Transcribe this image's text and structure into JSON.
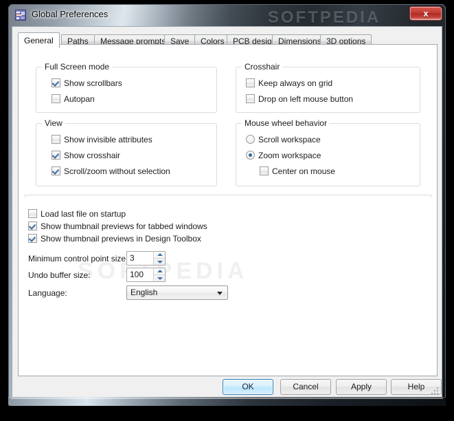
{
  "window": {
    "title": "Global Preferences",
    "icon": "app-icon",
    "close_label": "x",
    "watermark": "SOFTPEDIA"
  },
  "tabs": [
    {
      "label": "General",
      "active": true
    },
    {
      "label": "Paths",
      "active": false
    },
    {
      "label": "Message prompts",
      "active": false
    },
    {
      "label": "Save",
      "active": false
    },
    {
      "label": "Colors",
      "active": false
    },
    {
      "label": "PCB design",
      "active": false
    },
    {
      "label": "Dimensions",
      "active": false
    },
    {
      "label": "3D options",
      "active": false
    }
  ],
  "groups": {
    "fullscreen": {
      "title": "Full Screen mode",
      "options": [
        {
          "label": "Show scrollbars",
          "checked": true
        },
        {
          "label": "Autopan",
          "checked": false
        }
      ]
    },
    "crosshair": {
      "title": "Crosshair",
      "options": [
        {
          "label": "Keep always on grid",
          "checked": false
        },
        {
          "label": "Drop on left mouse button",
          "checked": false
        }
      ]
    },
    "view": {
      "title": "View",
      "options": [
        {
          "label": "Show invisible attributes",
          "checked": false
        },
        {
          "label": "Show crosshair",
          "checked": true
        },
        {
          "label": "Scroll/zoom without selection",
          "checked": true
        }
      ]
    },
    "mousewheel": {
      "title": "Mouse wheel behavior",
      "radios": [
        {
          "label": "Scroll workspace",
          "selected": false
        },
        {
          "label": "Zoom workspace",
          "selected": true
        }
      ],
      "sub_option": {
        "label": "Center on mouse",
        "checked": false
      }
    }
  },
  "lower_options": [
    {
      "label": "Load last file on startup",
      "checked": false
    },
    {
      "label": "Show thumbnail previews for tabbed windows",
      "checked": true
    },
    {
      "label": "Show thumbnail previews in Design Toolbox",
      "checked": true
    }
  ],
  "fields": {
    "min_control_point": {
      "label": "Minimum control point size:",
      "value": "3"
    },
    "undo_buffer": {
      "label": "Undo buffer size:",
      "value": "100"
    },
    "language": {
      "label": "Language:",
      "value": "English"
    }
  },
  "footer": {
    "ok": "OK",
    "cancel": "Cancel",
    "apply": "Apply",
    "help": "Help"
  },
  "colors": {
    "accent_check": "#3a6ea5",
    "default_button": "#bee6fd",
    "close_button": "#c23a31",
    "panel": "#ffffff",
    "dialog": "#f0f0f0"
  }
}
